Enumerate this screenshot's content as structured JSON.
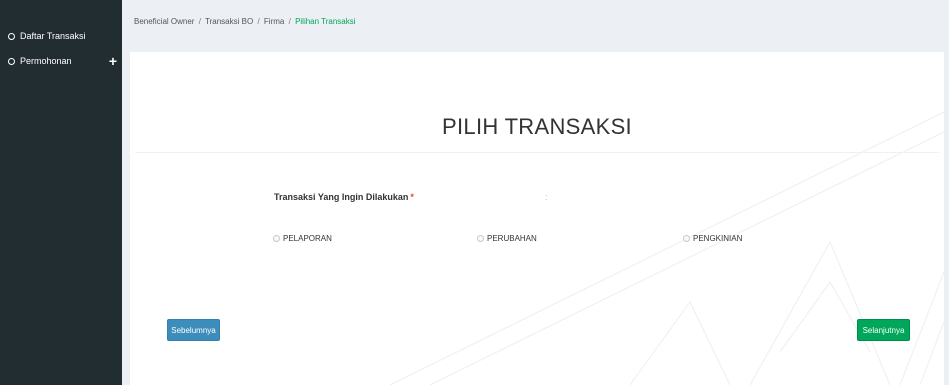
{
  "sidebar": {
    "items": [
      {
        "label": "Daftar Transaksi"
      },
      {
        "label": "Permohonan",
        "expand_symbol": "+"
      }
    ]
  },
  "breadcrumb": {
    "separator": "/",
    "items": [
      "Beneficial Owner",
      "Transaksi BO",
      "Firma",
      "Pilihan Transaksi"
    ]
  },
  "card": {
    "title": "PILIH TRANSAKSI",
    "field_label": "Transaksi Yang Ingin Dilakukan",
    "required_mark": "*",
    "colon": ":",
    "options": [
      {
        "label": "PELAPORAN",
        "selected": false
      },
      {
        "label": "PERUBAHAN",
        "selected": false
      },
      {
        "label": "PENGKINIAN",
        "selected": false
      }
    ]
  },
  "buttons": {
    "previous": "Sebelumnya",
    "next": "Selanjutnya"
  },
  "colors": {
    "sidebar": "#222d32",
    "background": "#ecf0f5",
    "primary": "#3c8dbc",
    "success": "#00a65a",
    "required": "#dd4b39"
  }
}
